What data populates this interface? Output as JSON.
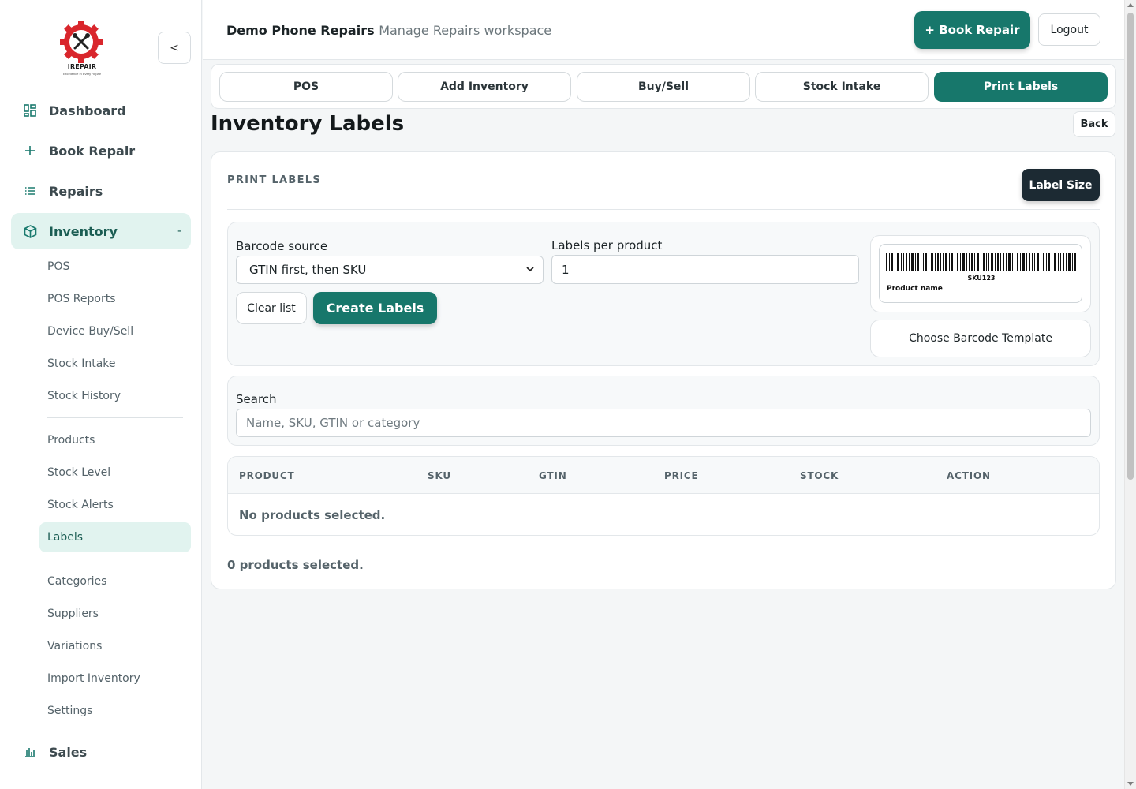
{
  "sidebar": {
    "logo": {
      "brand": "IREPAIR",
      "tagline": "Excellence In Every Repair",
      "gear_color": "#d9262c"
    },
    "collapse_label": "<",
    "main_items": [
      {
        "label": "Dashboard",
        "icon": "dashboard-icon"
      },
      {
        "label": "Book Repair",
        "icon": "plus-icon"
      },
      {
        "label": "Repairs",
        "icon": "list-icon"
      },
      {
        "label": "Inventory",
        "icon": "box-icon",
        "active": true,
        "toggle": "-"
      },
      {
        "label": "Sales",
        "icon": "bar-chart-icon"
      }
    ],
    "inventory_subitems": [
      "POS",
      "POS Reports",
      "Device Buy/Sell",
      "Stock Intake",
      "Stock History",
      "Products",
      "Stock Level",
      "Stock Alerts",
      "Labels",
      "Categories",
      "Suppliers",
      "Variations",
      "Import Inventory",
      "Settings"
    ],
    "active_subitem": "Labels"
  },
  "header": {
    "shop_name": "Demo Phone Repairs",
    "workspace": "Manage Repairs workspace",
    "book_repair_label": "+ Book Repair",
    "logout_label": "Logout"
  },
  "tabs": [
    {
      "label": "POS"
    },
    {
      "label": "Add Inventory"
    },
    {
      "label": "Buy/Sell"
    },
    {
      "label": "Stock Intake"
    },
    {
      "label": "Print Labels",
      "active": true
    }
  ],
  "page": {
    "title": "Inventory Labels",
    "back_label": "Back"
  },
  "print_labels": {
    "section_title": "PRINT LABELS",
    "label_size_label": "Label Size",
    "barcode_source_label": "Barcode source",
    "barcode_source_value": "GTIN first, then SKU",
    "labels_per_product_label": "Labels per product",
    "labels_per_product_value": "1",
    "clear_label": "Clear list",
    "create_label": "Create Labels",
    "preview": {
      "sku": "SKU123",
      "product_name": "Product name"
    },
    "template_label": "Choose Barcode Template",
    "search_label": "Search",
    "search_placeholder": "Name, SKU, GTIN or category",
    "table": {
      "columns": [
        "PRODUCT",
        "SKU",
        "GTIN",
        "PRICE",
        "STOCK",
        "ACTION"
      ],
      "empty_text": "No products selected."
    },
    "selected_count_text": "0 products selected."
  },
  "colors": {
    "accent": "#17776b",
    "dark_button": "#1c2a33",
    "active_bg": "#e1f3ef"
  }
}
